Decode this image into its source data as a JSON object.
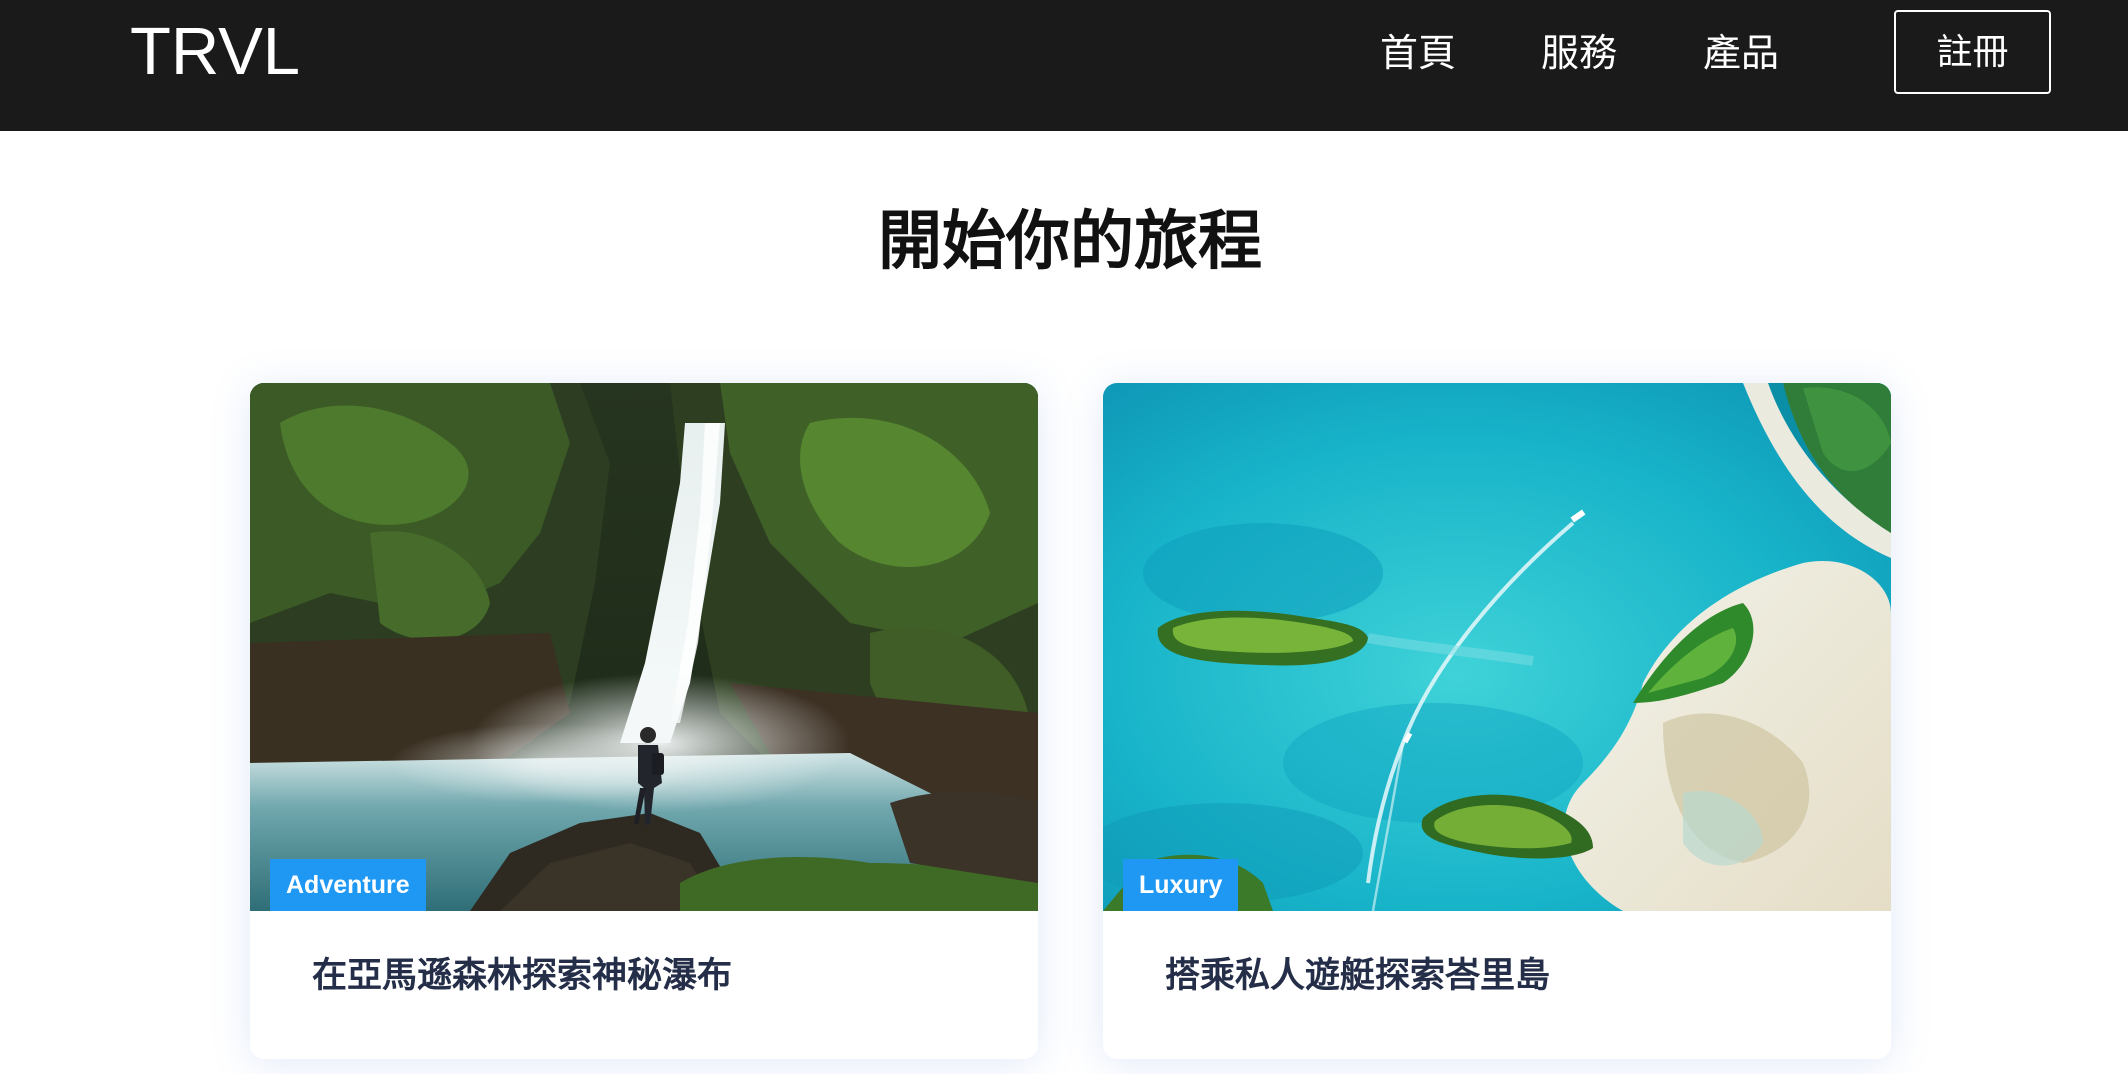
{
  "navbar": {
    "logo": "TRVL",
    "links": [
      "首頁",
      "服務",
      "產品"
    ],
    "signup_label": "註冊",
    "background": "#1b1a1a"
  },
  "main": {
    "title": "開始你的旅程"
  },
  "cards": [
    {
      "tag": "Adventure",
      "caption": "在亞馬遜森林探索神秘瀑布",
      "image_icon": "waterfall-photo"
    },
    {
      "tag": "Luxury",
      "caption": "搭乘私人遊艇探索峇里島",
      "image_icon": "aerial-island-photo"
    }
  ],
  "colors": {
    "tag_accent": "#1f98f4",
    "caption_text": "#252e48"
  }
}
